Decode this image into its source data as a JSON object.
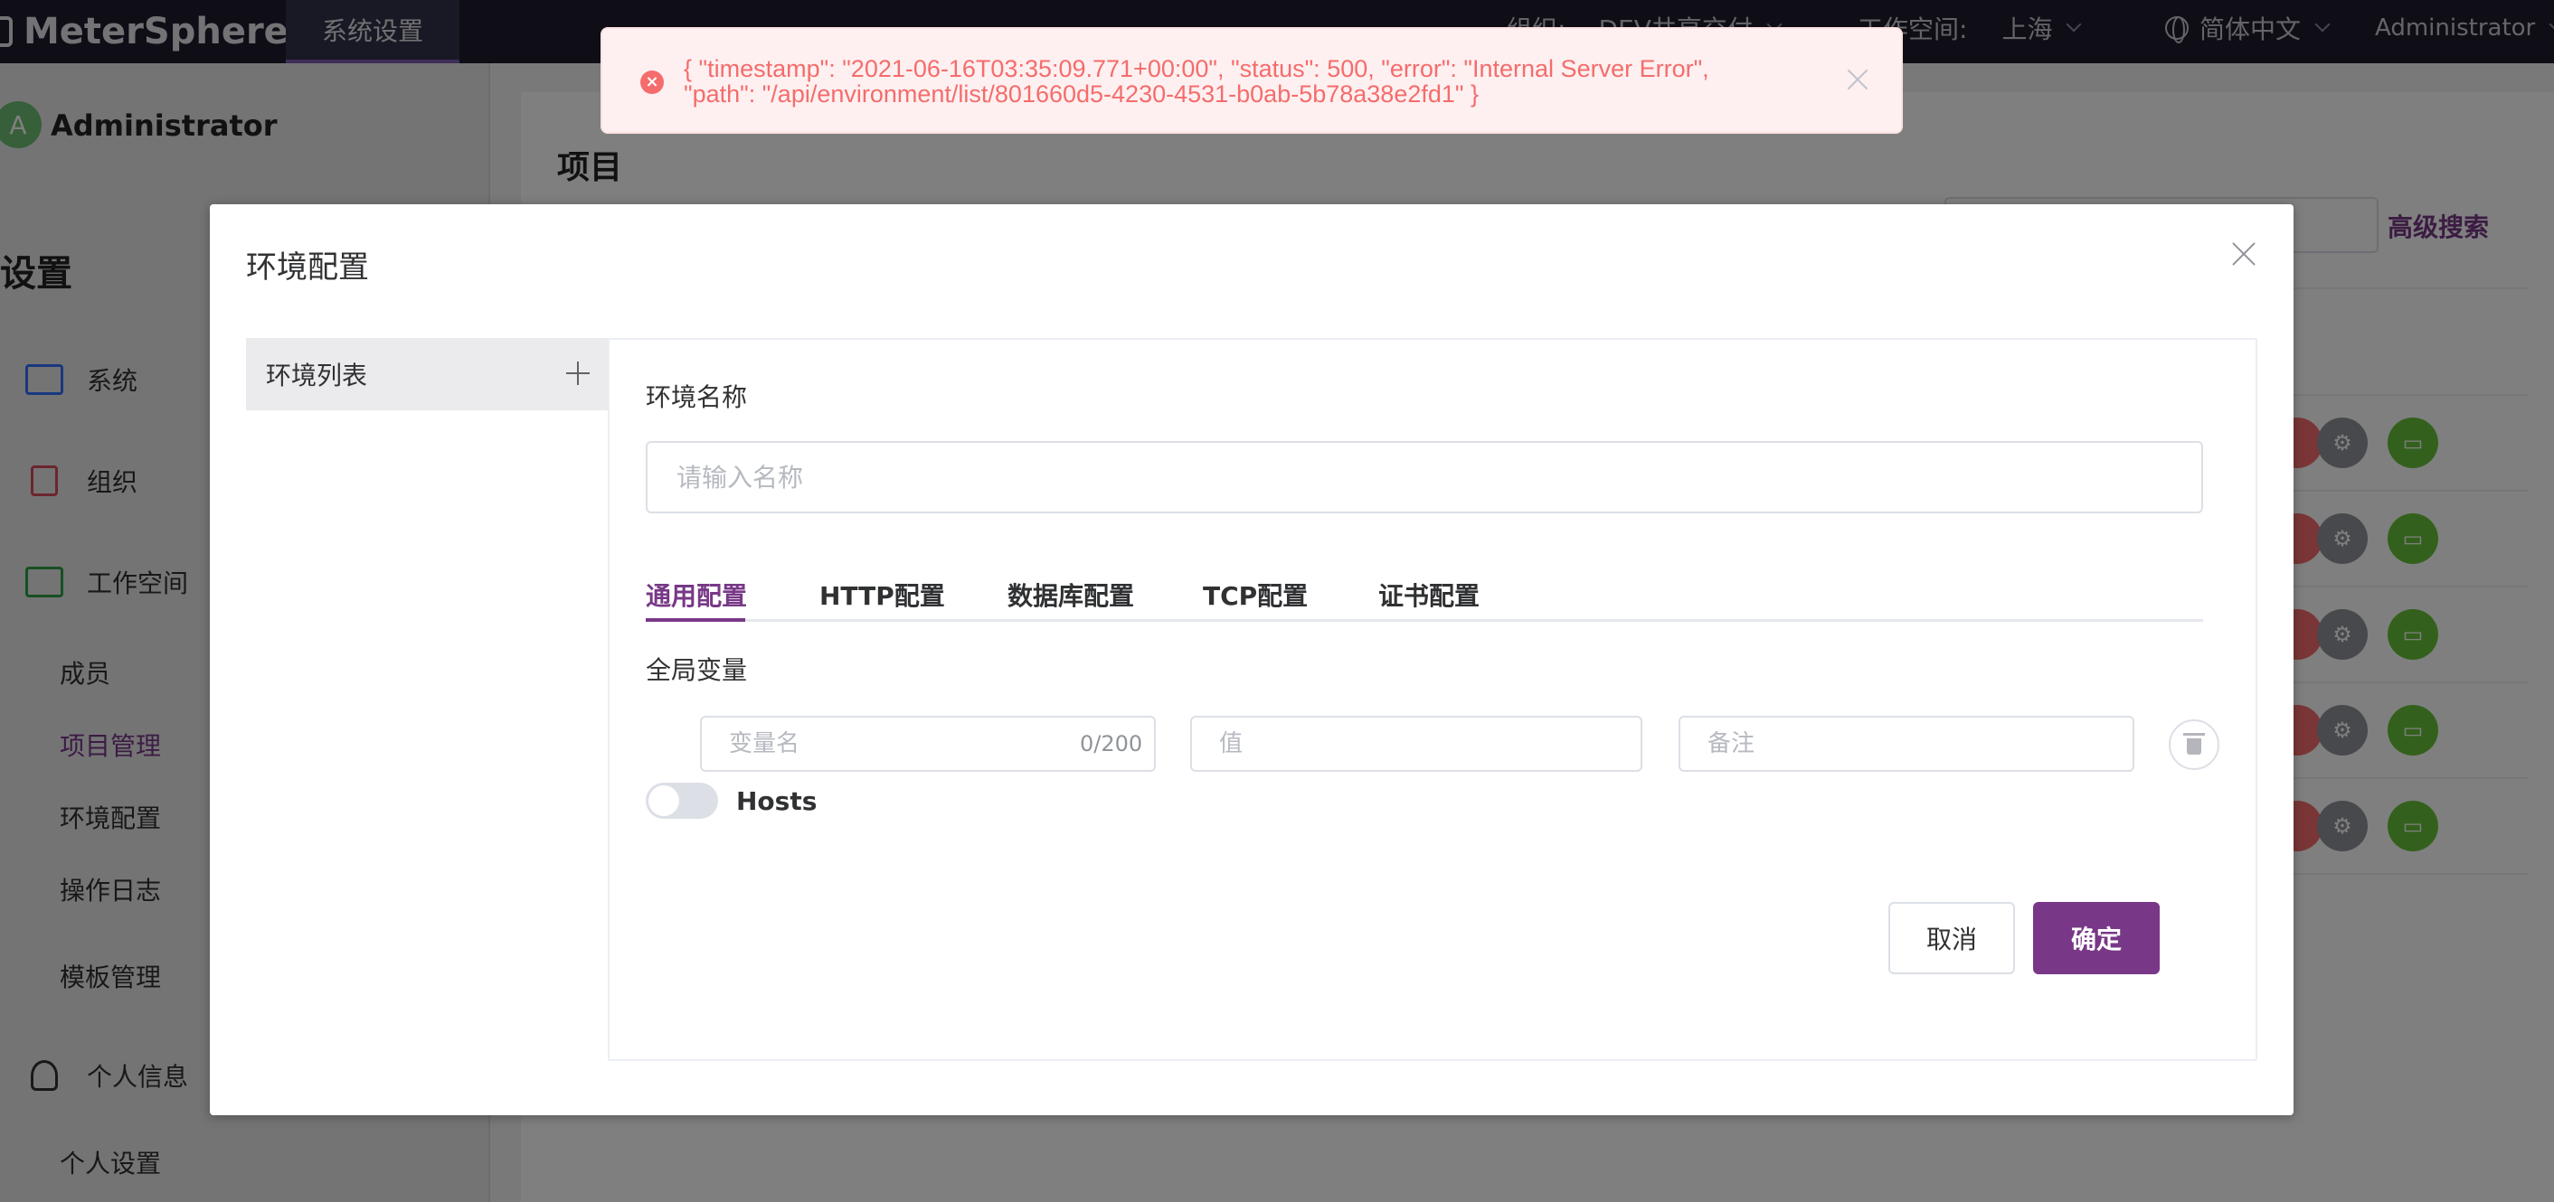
{
  "topbar": {
    "brand": "MeterSphere",
    "active_tab": "系统设置",
    "org_label": "组织:",
    "org_value": "DEV共享交付",
    "workspace_label": "工作空间:",
    "workspace_value": "上海",
    "language": "简体中文",
    "user": "Administrator"
  },
  "sidebar": {
    "avatar_letter": "A",
    "user": "Administrator",
    "section_title": "设置",
    "groups": [
      {
        "label": "系统",
        "icon": "id-card-icon",
        "color": "#3370ff"
      },
      {
        "label": "组织",
        "icon": "building-icon",
        "color": "#d94a5b"
      },
      {
        "label": "工作空间",
        "icon": "list-icon",
        "color": "#2f9e44"
      }
    ],
    "workspace_items": [
      "成员",
      "项目管理",
      "环境配置",
      "操作日志"
    ],
    "active_item": "项目管理",
    "template": "模板管理",
    "personal_group": "个人信息",
    "personal_item": "个人设置"
  },
  "background": {
    "title": "项目",
    "advanced_search": "高级搜索"
  },
  "dialog": {
    "title": "环境配置",
    "env_list_label": "环境列表",
    "name_label": "环境名称",
    "name_placeholder": "请输入名称",
    "tabs": [
      "通用配置",
      "HTTP配置",
      "数据库配置",
      "TCP配置",
      "证书配置"
    ],
    "active_tab": "通用配置",
    "global_vars_label": "全局变量",
    "var_name_placeholder": "变量名",
    "var_name_count": "0/200",
    "var_value_placeholder": "值",
    "var_remark_placeholder": "备注",
    "hosts_label": "Hosts",
    "hosts_enabled": false,
    "cancel": "取消",
    "confirm": "确定"
  },
  "toast": {
    "type": "error",
    "line1": "{ \"timestamp\": \"2021-06-16T03:35:09.771+00:00\", \"status\": 500, \"error\": \"Internal Server Error\",",
    "line2": "\"path\": \"/api/environment/list/801660d5-4230-4531-b0ab-5b78a38e2fd1\" }"
  },
  "colors": {
    "accent": "#783887",
    "error": "#f56c6c",
    "topbar": "#1e1d2e"
  }
}
